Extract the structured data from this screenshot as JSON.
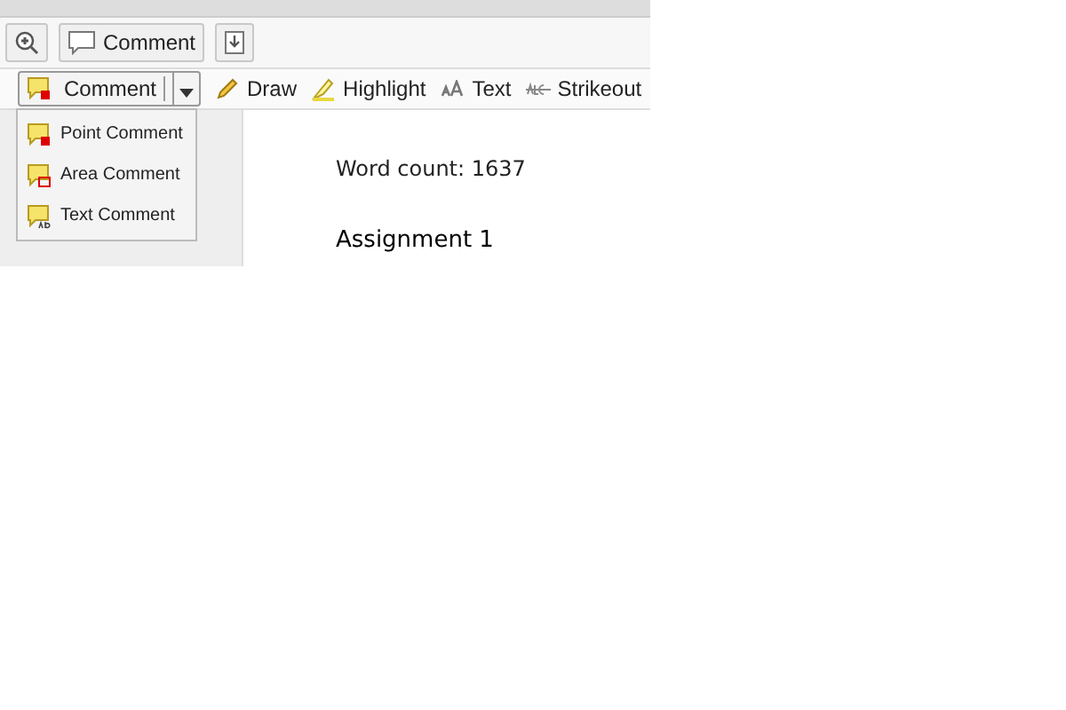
{
  "toolbar": {
    "comment_button": "Comment"
  },
  "annotation_bar": {
    "comment_split": "Comment",
    "menu_open": true,
    "tools": [
      {
        "kind": "draw",
        "label": "Draw"
      },
      {
        "kind": "highlight",
        "label": "Highlight"
      },
      {
        "kind": "text",
        "label": "Text"
      },
      {
        "kind": "strikeout",
        "label": "Strikeout"
      }
    ]
  },
  "comment_menu": [
    {
      "kind": "point",
      "label": "Point Comment"
    },
    {
      "kind": "area",
      "label": "Area Comment"
    },
    {
      "kind": "text",
      "label": "Text Comment"
    }
  ],
  "document": {
    "word_count": "Word count: 1637",
    "heading": "Assignment 1"
  }
}
